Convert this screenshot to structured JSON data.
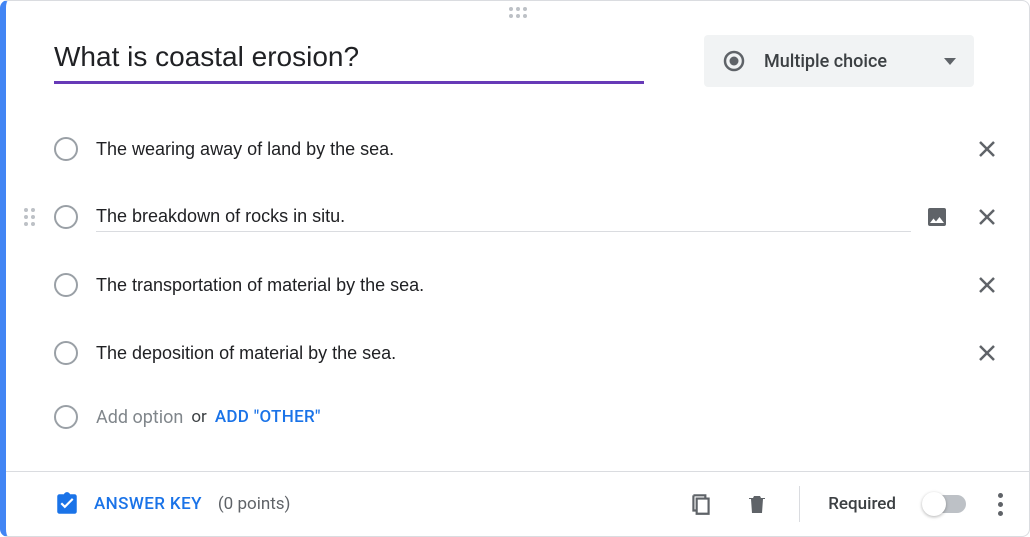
{
  "question": {
    "text": "What is coastal erosion?",
    "type_label": "Multiple choice"
  },
  "options": [
    {
      "text": "The wearing away of land by the sea."
    },
    {
      "text": "The breakdown of rocks in situ."
    },
    {
      "text": "The transportation of material by the sea."
    },
    {
      "text": "The deposition of material by the sea."
    }
  ],
  "add_option": {
    "placeholder": "Add option",
    "or": "or",
    "other_label": "ADD \"OTHER\""
  },
  "footer": {
    "answer_key_label": "ANSWER KEY",
    "points_label": "(0 points)",
    "required_label": "Required"
  }
}
